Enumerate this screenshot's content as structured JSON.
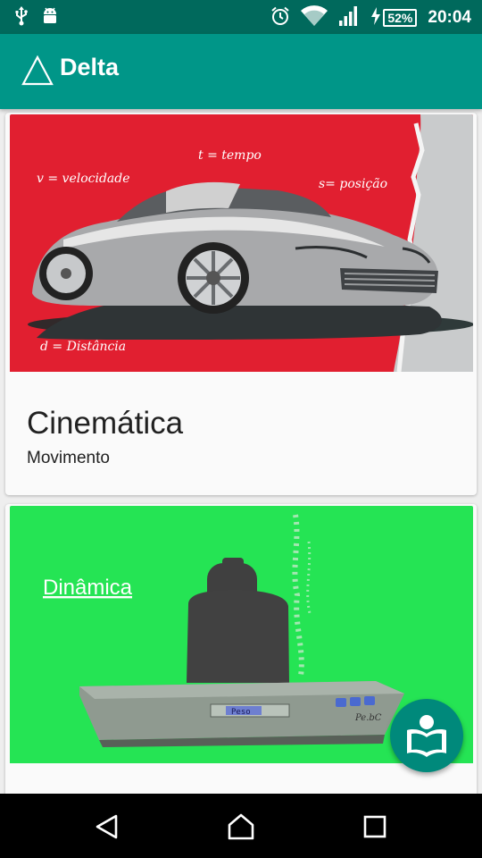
{
  "status_bar": {
    "left_icons": [
      "usb-icon",
      "android-icon"
    ],
    "right_icons": [
      "alarm-icon",
      "wifi-icon",
      "signal-icon",
      "charging-icon"
    ],
    "battery": "52%",
    "time": "20:04"
  },
  "app_bar": {
    "title": "Delta",
    "logo_icon": "triangle-logo-icon",
    "color": "#009688"
  },
  "cards": [
    {
      "title": "Cinemática",
      "subtitle": "Movimento",
      "image": {
        "background_color": "#e11f30",
        "labels": {
          "t": "t = tempo",
          "v": "v = velocidade",
          "s": "s= posição",
          "d": "d = Distância"
        }
      }
    },
    {
      "image": {
        "background_color": "#25e454",
        "heading": "Dinâmica",
        "scale_display": "Peso",
        "scale_label": "Pe.bC"
      }
    }
  ],
  "fab": {
    "icon": "open-book-reader-icon",
    "color": "#00897b"
  },
  "nav_bar": {
    "icons": [
      "back-icon",
      "home-icon",
      "recents-icon"
    ]
  }
}
